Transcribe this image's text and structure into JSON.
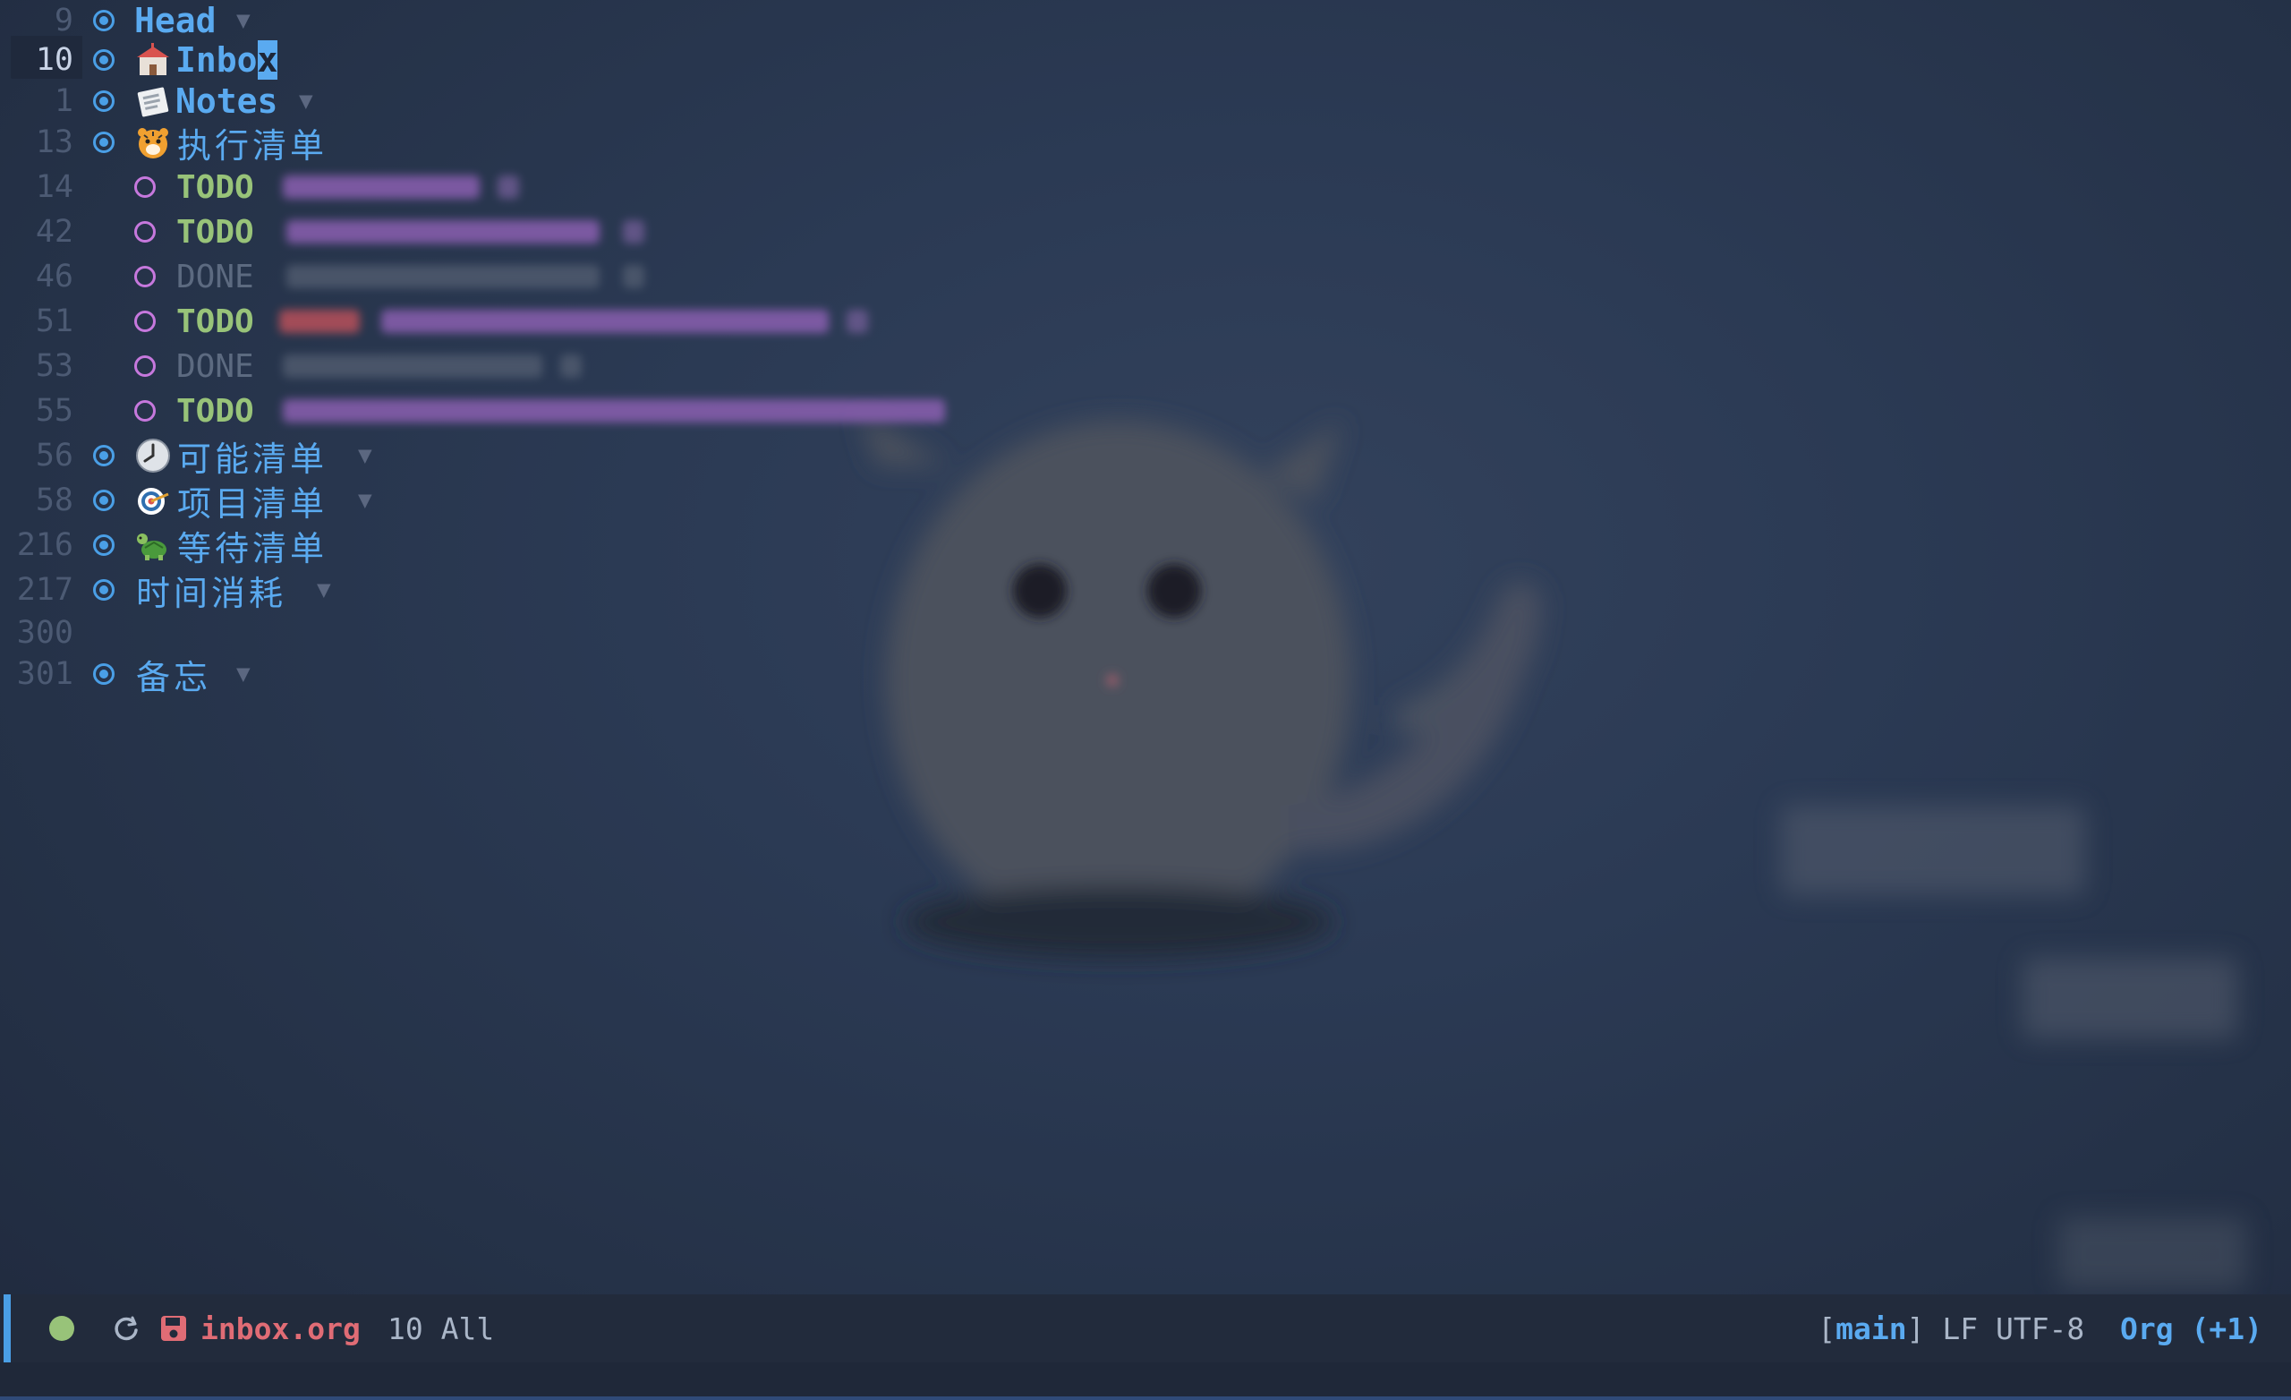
{
  "buffer": {
    "lines": [
      {
        "num": "9",
        "kind": "heading",
        "emoji": null,
        "text": "Head",
        "folded": true
      },
      {
        "num": "10",
        "kind": "heading",
        "emoji": "school-emoji",
        "text_pre": "Inbo",
        "text_cursor": "x",
        "folded": false,
        "current": true
      },
      {
        "num": "1",
        "kind": "heading",
        "emoji": "newspaper-emoji",
        "text": "Notes",
        "folded": true
      },
      {
        "num": "13",
        "kind": "heading",
        "emoji": "tiger-emoji",
        "text": "执行清单",
        "folded": false
      },
      {
        "num": "14",
        "kind": "task",
        "keyword": "TODO"
      },
      {
        "num": "42",
        "kind": "task",
        "keyword": "TODO"
      },
      {
        "num": "46",
        "kind": "task",
        "keyword": "DONE"
      },
      {
        "num": "51",
        "kind": "task",
        "keyword": "TODO"
      },
      {
        "num": "53",
        "kind": "task",
        "keyword": "DONE"
      },
      {
        "num": "55",
        "kind": "task",
        "keyword": "TODO"
      },
      {
        "num": "56",
        "kind": "heading",
        "emoji": "clock-emoji",
        "text": "可能清单",
        "folded": true
      },
      {
        "num": "58",
        "kind": "heading",
        "emoji": "target-emoji",
        "text": "项目清单",
        "folded": true
      },
      {
        "num": "216",
        "kind": "heading",
        "emoji": "turtle-emoji",
        "text": "等待清单",
        "folded": false
      },
      {
        "num": "217",
        "kind": "heading",
        "emoji": null,
        "text": "时间消耗",
        "folded": true
      },
      {
        "num": "300",
        "kind": "blank"
      },
      {
        "num": "301",
        "kind": "heading",
        "emoji": null,
        "text": "备忘",
        "folded": true
      }
    ],
    "fold_glyph": "▼"
  },
  "modeline": {
    "file": "inbox.org",
    "position": "10 All",
    "branch_open": "[",
    "branch": "main",
    "branch_close": "]",
    "eol": "LF",
    "encoding": "UTF-8",
    "mode": "Org (+1)"
  },
  "colors": {
    "heading": "#5aaaf0",
    "todo": "#98c379",
    "done": "#5c6a80",
    "bullet": "#4a9fe6",
    "sub_bullet": "#c678dd",
    "filename": "#e06c75",
    "status_ok": "#98c379",
    "background": "#253248"
  }
}
